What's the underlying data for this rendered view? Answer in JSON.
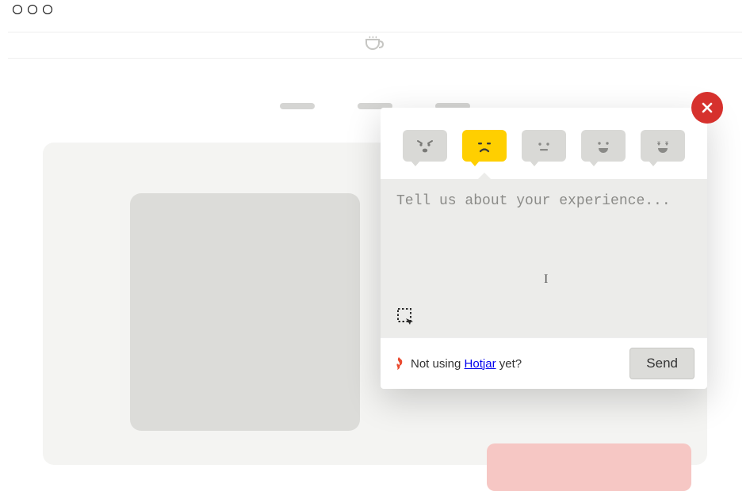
{
  "widget": {
    "ratings": [
      {
        "key": "angry",
        "selected": false
      },
      {
        "key": "sad",
        "selected": true
      },
      {
        "key": "neutral",
        "selected": false
      },
      {
        "key": "happy",
        "selected": false
      },
      {
        "key": "love",
        "selected": false
      }
    ],
    "textarea_placeholder": "Tell us about your experience...",
    "textarea_value": "",
    "promo_prefix": "Not using ",
    "promo_link": "Hotjar",
    "promo_suffix": " yet?",
    "send_label": "Send",
    "colors": {
      "close_bg": "#d6312d",
      "selected_bg": "#ffcf00",
      "unselected_bg": "#d9d9d6"
    }
  }
}
